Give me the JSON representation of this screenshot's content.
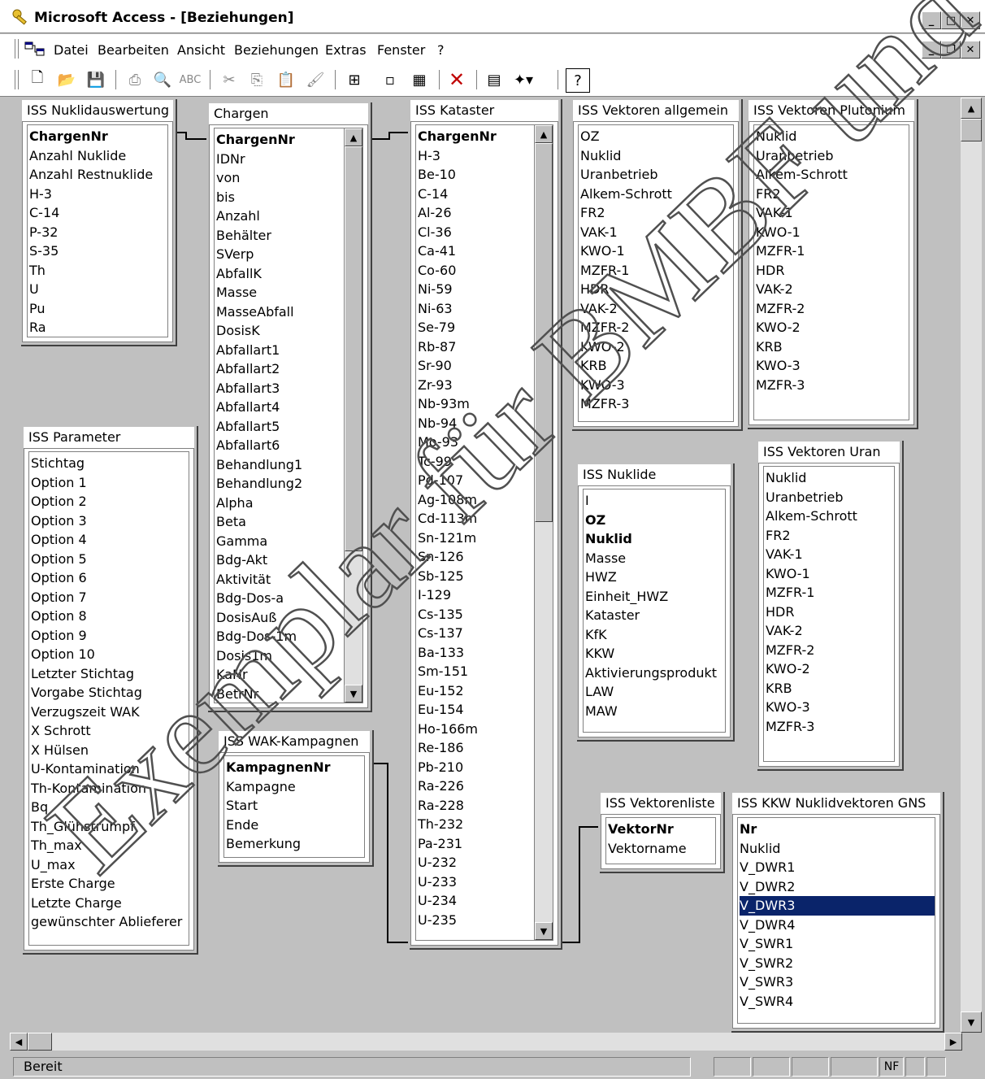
{
  "window": {
    "title": "Microsoft Access - [Beziehungen]"
  },
  "menu": [
    "Datei",
    "Bearbeiten",
    "Ansicht",
    "Beziehungen",
    "Extras",
    "Fenster",
    "?"
  ],
  "toolbar_icons": [
    "new-icon",
    "open-icon",
    "save-icon",
    "print-icon",
    "print-preview-icon",
    "spelling-icon",
    "cut-icon",
    "copy-icon",
    "paste-icon",
    "format-painter-icon",
    "show-table-icon",
    "show-direct-icon",
    "show-all-icon",
    "delete-icon",
    "properties-icon",
    "new-object-icon",
    "help-icon"
  ],
  "tables": {
    "nuklidauswertung": {
      "title": "ISS Nuklidauswertung",
      "fields": [
        {
          "n": "ChargenNr",
          "k": true
        },
        {
          "n": "Anzahl Nuklide"
        },
        {
          "n": "Anzahl Restnuklide"
        },
        {
          "n": "H-3"
        },
        {
          "n": "C-14"
        },
        {
          "n": "P-32"
        },
        {
          "n": "S-35"
        },
        {
          "n": "Th"
        },
        {
          "n": "U"
        },
        {
          "n": "Pu"
        },
        {
          "n": "Ra"
        }
      ]
    },
    "chargen": {
      "title": "Chargen",
      "fields": [
        {
          "n": "ChargenNr",
          "k": true
        },
        {
          "n": "IDNr"
        },
        {
          "n": "von"
        },
        {
          "n": "bis"
        },
        {
          "n": "Anzahl"
        },
        {
          "n": "Behälter"
        },
        {
          "n": "SVerp"
        },
        {
          "n": "AbfallK"
        },
        {
          "n": "Masse"
        },
        {
          "n": "MasseAbfall"
        },
        {
          "n": "DosisK"
        },
        {
          "n": "Abfallart1"
        },
        {
          "n": "Abfallart2"
        },
        {
          "n": "Abfallart3"
        },
        {
          "n": "Abfallart4"
        },
        {
          "n": "Abfallart5"
        },
        {
          "n": "Abfallart6"
        },
        {
          "n": "Behandlung1"
        },
        {
          "n": "Behandlung2"
        },
        {
          "n": "Alpha"
        },
        {
          "n": "Beta"
        },
        {
          "n": "Gamma"
        },
        {
          "n": "Bdg-Akt"
        },
        {
          "n": "Aktivität"
        },
        {
          "n": "Bdg-Dos-a"
        },
        {
          "n": "DosisAuß"
        },
        {
          "n": "Bdg-Dos-1m"
        },
        {
          "n": "Dosis1m"
        },
        {
          "n": "KaNr"
        },
        {
          "n": "BetrNr"
        }
      ]
    },
    "kataster": {
      "title": "ISS Kataster",
      "fields": [
        {
          "n": "ChargenNr",
          "k": true
        },
        {
          "n": "H-3"
        },
        {
          "n": "Be-10"
        },
        {
          "n": "C-14"
        },
        {
          "n": "Al-26"
        },
        {
          "n": "Cl-36"
        },
        {
          "n": "Ca-41"
        },
        {
          "n": "Co-60"
        },
        {
          "n": "Ni-59"
        },
        {
          "n": "Ni-63"
        },
        {
          "n": "Se-79"
        },
        {
          "n": "Rb-87"
        },
        {
          "n": "Sr-90"
        },
        {
          "n": "Zr-93"
        },
        {
          "n": "Nb-93m"
        },
        {
          "n": "Nb-94"
        },
        {
          "n": "Mo-93"
        },
        {
          "n": "Tc-99"
        },
        {
          "n": "Pd-107"
        },
        {
          "n": "Ag-108m"
        },
        {
          "n": "Cd-113m"
        },
        {
          "n": "Sn-121m"
        },
        {
          "n": "Sn-126"
        },
        {
          "n": "Sb-125"
        },
        {
          "n": "I-129"
        },
        {
          "n": "Cs-135"
        },
        {
          "n": "Cs-137"
        },
        {
          "n": "Ba-133"
        },
        {
          "n": "Sm-151"
        },
        {
          "n": "Eu-152"
        },
        {
          "n": "Eu-154"
        },
        {
          "n": "Ho-166m"
        },
        {
          "n": "Re-186"
        },
        {
          "n": "Pb-210"
        },
        {
          "n": "Ra-226"
        },
        {
          "n": "Ra-228"
        },
        {
          "n": "Th-232"
        },
        {
          "n": "Pa-231"
        },
        {
          "n": "U-232"
        },
        {
          "n": "U-233"
        },
        {
          "n": "U-234"
        },
        {
          "n": "U-235"
        }
      ]
    },
    "vektoren_allgemein": {
      "title": "ISS Vektoren allgemein",
      "fields": [
        {
          "n": "OZ"
        },
        {
          "n": "Nuklid"
        },
        {
          "n": "Uranbetrieb"
        },
        {
          "n": "Alkem-Schrott"
        },
        {
          "n": "FR2"
        },
        {
          "n": "VAK-1"
        },
        {
          "n": "KWO-1"
        },
        {
          "n": "MZFR-1"
        },
        {
          "n": "HDR"
        },
        {
          "n": "VAK-2"
        },
        {
          "n": "MZFR-2"
        },
        {
          "n": "KWO-2"
        },
        {
          "n": "KRB"
        },
        {
          "n": "KWO-3"
        },
        {
          "n": "MZFR-3"
        }
      ]
    },
    "vektoren_plutonium": {
      "title": "ISS Vektoren Plutonium",
      "fields": [
        {
          "n": "Nuklid"
        },
        {
          "n": "Uranbetrieb"
        },
        {
          "n": "Alkem-Schrott"
        },
        {
          "n": "FR2"
        },
        {
          "n": "VAK-1"
        },
        {
          "n": "KWO-1"
        },
        {
          "n": "MZFR-1"
        },
        {
          "n": "HDR"
        },
        {
          "n": "VAK-2"
        },
        {
          "n": "MZFR-2"
        },
        {
          "n": "KWO-2"
        },
        {
          "n": "KRB"
        },
        {
          "n": "KWO-3"
        },
        {
          "n": "MZFR-3"
        }
      ]
    },
    "parameter": {
      "title": "ISS Parameter",
      "fields": [
        {
          "n": "Stichtag"
        },
        {
          "n": "Option 1"
        },
        {
          "n": "Option 2"
        },
        {
          "n": "Option 3"
        },
        {
          "n": "Option 4"
        },
        {
          "n": "Option 5"
        },
        {
          "n": "Option 6"
        },
        {
          "n": "Option 7"
        },
        {
          "n": "Option 8"
        },
        {
          "n": "Option 9"
        },
        {
          "n": "Option 10"
        },
        {
          "n": "Letzter Stichtag"
        },
        {
          "n": "Vorgabe Stichtag"
        },
        {
          "n": "Verzugszeit WAK"
        },
        {
          "n": "X Schrott"
        },
        {
          "n": "X Hülsen"
        },
        {
          "n": "U-Kontamination"
        },
        {
          "n": "Th-Kontamination"
        },
        {
          "n": "Bq"
        },
        {
          "n": "Th_Glühstrumpf"
        },
        {
          "n": "Th_max"
        },
        {
          "n": "U_max"
        },
        {
          "n": "Erste Charge"
        },
        {
          "n": "Letzte Charge"
        },
        {
          "n": "gewünschter Ablieferer"
        }
      ]
    },
    "nuklide": {
      "title": "ISS Nuklide",
      "fields": [
        {
          "n": "I"
        },
        {
          "n": "OZ",
          "k": true
        },
        {
          "n": "Nuklid",
          "k": true
        },
        {
          "n": "Masse"
        },
        {
          "n": "HWZ"
        },
        {
          "n": "Einheit_HWZ"
        },
        {
          "n": "Kataster"
        },
        {
          "n": "KfK"
        },
        {
          "n": "KKW"
        },
        {
          "n": "Aktivierungsprodukt"
        },
        {
          "n": "LAW"
        },
        {
          "n": "MAW"
        }
      ]
    },
    "vektoren_uran": {
      "title": "ISS Vektoren Uran",
      "fields": [
        {
          "n": "Nuklid"
        },
        {
          "n": "Uranbetrieb"
        },
        {
          "n": "Alkem-Schrott"
        },
        {
          "n": "FR2"
        },
        {
          "n": "VAK-1"
        },
        {
          "n": "KWO-1"
        },
        {
          "n": "MZFR-1"
        },
        {
          "n": "HDR"
        },
        {
          "n": "VAK-2"
        },
        {
          "n": "MZFR-2"
        },
        {
          "n": "KWO-2"
        },
        {
          "n": "KRB"
        },
        {
          "n": "KWO-3"
        },
        {
          "n": "MZFR-3"
        }
      ]
    },
    "wak": {
      "title": "ISS WAK-Kampagnen",
      "fields": [
        {
          "n": "KampagnenNr",
          "k": true
        },
        {
          "n": "Kampagne"
        },
        {
          "n": "Start"
        },
        {
          "n": "Ende"
        },
        {
          "n": "Bemerkung"
        }
      ]
    },
    "vektorenliste": {
      "title": "ISS Vektorenliste",
      "fields": [
        {
          "n": "VektorNr",
          "k": true
        },
        {
          "n": "Vektorname"
        }
      ]
    },
    "kkw": {
      "title": "ISS KKW Nuklidvektoren GNS",
      "fields": [
        {
          "n": "Nr",
          "k": true
        },
        {
          "n": "Nuklid"
        },
        {
          "n": "V_DWR1"
        },
        {
          "n": "V_DWR2"
        },
        {
          "n": "V_DWR3",
          "sel": true
        },
        {
          "n": "V_DWR4"
        },
        {
          "n": "V_SWR1"
        },
        {
          "n": "V_SWR2"
        },
        {
          "n": "V_SWR3"
        },
        {
          "n": "V_SWR4"
        }
      ]
    }
  },
  "status": {
    "text": "Bereit",
    "nf": "NF"
  },
  "watermark": "Exemplar für BMBF und BMU",
  "colors": {
    "selection": "#0a246a",
    "background": "#c0c0c0"
  }
}
